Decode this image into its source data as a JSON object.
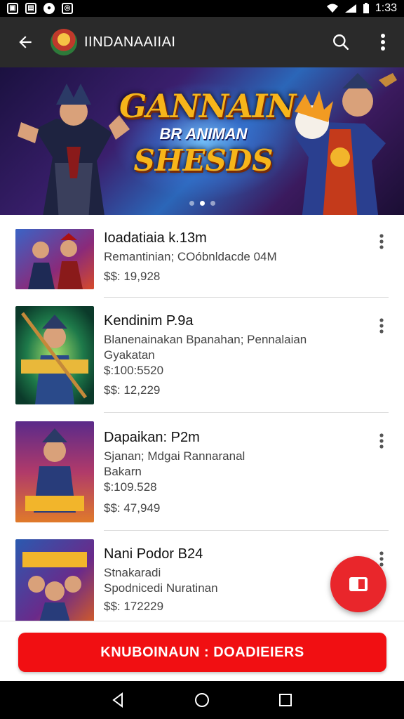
{
  "status_bar": {
    "time": "1:33",
    "left_icons": [
      "photo-icon",
      "gallery-icon",
      "notification-icon",
      "instagram-icon"
    ]
  },
  "app_bar": {
    "title": "IINDANAAIIAI"
  },
  "banner": {
    "line1": "GANNAIN",
    "line2": "BR ANIMAN",
    "line3": "SHESDS",
    "pages": 3,
    "active_page": 1
  },
  "items": [
    {
      "title": "Ioadatiaia k.13m",
      "lines": [
        "Remantinian; COóbnldacde 04M"
      ],
      "price": "$$: 19,928"
    },
    {
      "title": "Kendinim P.9a",
      "lines": [
        "Blanenainakan Bpanahan; Pennalaian",
        "Gyakatan",
        "$:100:5520"
      ],
      "price": "$$: 12,229"
    },
    {
      "title": "Dapaikan: P2m",
      "lines": [
        "Sjanan; Mdgai Rannaranal",
        "Bakarn",
        "$:109.528"
      ],
      "price": "$$: 47,949"
    },
    {
      "title": "Nani Podor B24",
      "lines": [
        "Stnakaradi",
        "Spodnicedi Nuratinan"
      ],
      "price": "$$: 172229"
    }
  ],
  "cta": {
    "label": "KNUBOINAUN : DOADIEIERS"
  },
  "colors": {
    "accent": "#f10f12",
    "app_bar": "#2a2a2a"
  }
}
